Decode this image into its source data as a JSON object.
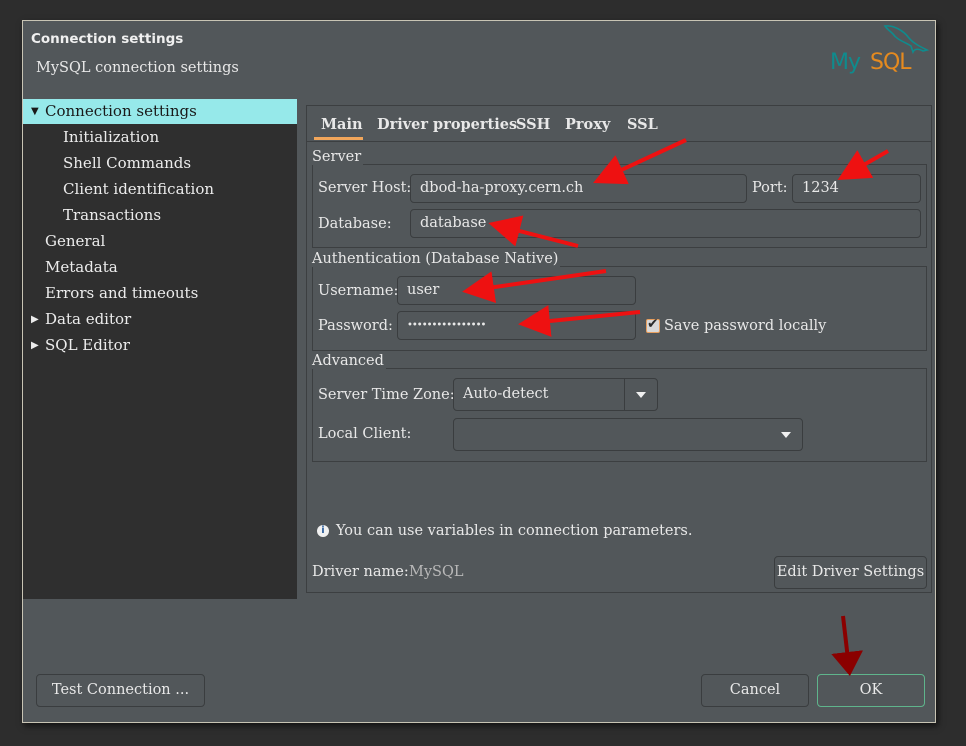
{
  "dialog": {
    "title": "Connection settings",
    "subtitle": "MySQL connection settings",
    "logo": {
      "my": "My",
      "sql": "SQL",
      "icon": "mysql-dolphin-logo"
    }
  },
  "sidebar": {
    "items": [
      {
        "label": "Connection settings",
        "expander": "expanded",
        "selected": true
      },
      {
        "label": "Initialization"
      },
      {
        "label": "Shell Commands"
      },
      {
        "label": "Client identification"
      },
      {
        "label": "Transactions"
      },
      {
        "label": "General"
      },
      {
        "label": "Metadata"
      },
      {
        "label": "Errors and timeouts"
      },
      {
        "label": "Data editor",
        "expander": "collapsed"
      },
      {
        "label": "SQL Editor",
        "expander": "collapsed"
      }
    ]
  },
  "tabs": [
    {
      "label": "Main",
      "active": true
    },
    {
      "label": "Driver properties"
    },
    {
      "label": "SSH"
    },
    {
      "label": "Proxy"
    },
    {
      "label": "SSL"
    }
  ],
  "server": {
    "group_label": "Server",
    "host_label": "Server Host:",
    "host_value": "dbod-ha-proxy.cern.ch",
    "port_label": "Port:",
    "port_value": "1234",
    "database_label": "Database:",
    "database_value": "database"
  },
  "auth": {
    "group_label": "Authentication (Database Native)",
    "username_label": "Username:",
    "username_value": "user",
    "password_label": "Password:",
    "password_value": "••••••••••••••••",
    "save_password_label": "Save password locally",
    "save_password_checked": true
  },
  "advanced": {
    "group_label": "Advanced",
    "timezone_label": "Server Time Zone:",
    "timezone_value": "Auto-detect",
    "local_client_label": "Local Client:",
    "local_client_value": ""
  },
  "info": {
    "text": "You can use variables in connection parameters."
  },
  "driver": {
    "label": "Driver name:",
    "value": "MySQL",
    "edit_button": "Edit Driver Settings"
  },
  "buttons": {
    "test_connection": "Test Connection ...",
    "cancel": "Cancel",
    "ok": "OK"
  },
  "annotation_colors": {
    "arrow_red": "#ee1111",
    "arrow_dark_red": "#8b0000"
  }
}
